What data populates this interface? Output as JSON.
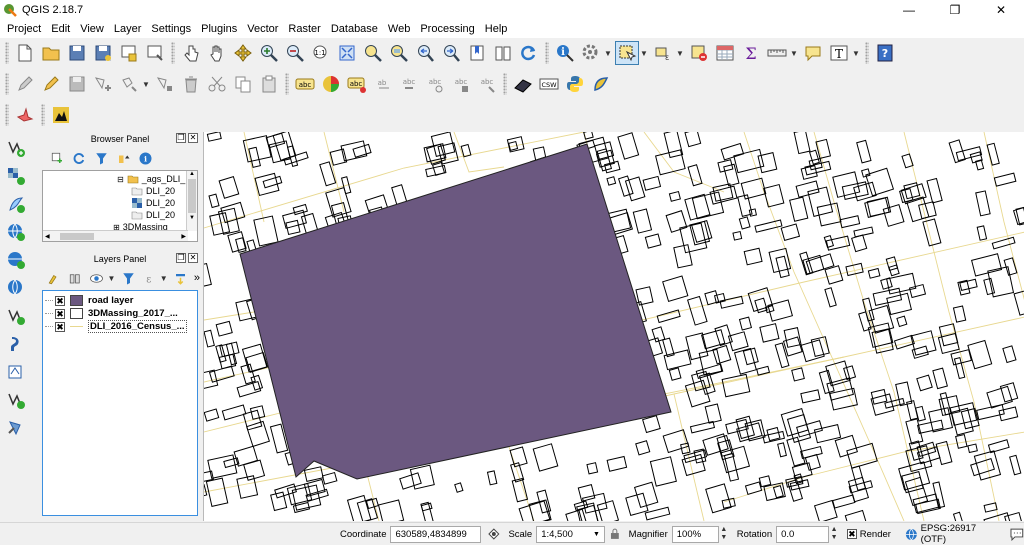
{
  "window": {
    "title": "QGIS 2.18.7",
    "minimize_glyph": "—",
    "restore_glyph": "❐",
    "close_glyph": "✕"
  },
  "menu": [
    "Project",
    "Edit",
    "View",
    "Layer",
    "Settings",
    "Plugins",
    "Vector",
    "Raster",
    "Database",
    "Web",
    "Processing",
    "Help"
  ],
  "toolbars": {
    "row1_icons": [
      "new-project-icon",
      "open-project-icon",
      "save-project-icon",
      "save-as-icon",
      "new-print-composer-icon",
      "composer-manager-icon",
      "touch-zoom-icon",
      "pan-icon",
      "pan-to-selection-icon",
      "zoom-in-icon",
      "zoom-out-icon",
      "zoom-native-icon",
      "zoom-full-icon",
      "zoom-to-selection-icon",
      "zoom-to-layer-icon",
      "zoom-last-icon",
      "zoom-next-icon",
      "new-bookmark-icon",
      "show-bookmarks-icon",
      "refresh-icon",
      "identify-icon",
      "run-action-icon",
      "select-features-icon",
      "select-by-value-icon",
      "deselect-icon",
      "attribute-table-icon",
      "statistics-icon",
      "measure-icon",
      "map-tips-icon",
      "text-annotation-icon",
      "help-icon"
    ],
    "row2_icons": [
      "current-edits-icon",
      "toggle-editing-icon",
      "save-edits-icon",
      "add-feature-icon",
      "move-feature-icon",
      "node-tool-icon",
      "delete-selected-icon",
      "cut-features-icon",
      "copy-features-icon",
      "paste-features-icon",
      "label-toolbar-icon",
      "diagram-icon",
      "pin-labels-icon",
      "show-hide-labels-icon",
      "move-label-icon",
      "rotate-label-icon",
      "change-label-icon",
      "unpin-label-icon",
      "georeferencer-icon",
      "csw-icon",
      "python-console-icon",
      "geocoding-icon"
    ],
    "row3_icons": [
      "plugin-a-icon",
      "plugin-b-icon"
    ]
  },
  "left_toolbar_icons": [
    "add-vector-layer-icon",
    "add-raster-layer-icon",
    "add-spatialite-icon",
    "add-wms-icon",
    "add-wcs-icon",
    "add-wfs-icon",
    "add-delimited-text-icon",
    "add-postgis-icon",
    "add-oracle-icon",
    "add-mssql-icon",
    "new-shapefile-icon",
    "processing-icon"
  ],
  "browser_panel": {
    "title": "Browser Panel",
    "items": [
      {
        "label": "_ags_DLI_",
        "icon": "folder-icon"
      },
      {
        "label": "DLI_20",
        "icon": "folder-icon"
      },
      {
        "label": "DLI_20",
        "icon": "raster-icon"
      },
      {
        "label": "DLI_20",
        "icon": "folder-icon"
      },
      {
        "label": "3DMassing_",
        "icon": "folder-icon"
      }
    ]
  },
  "layers_panel": {
    "title": "Layers Panel",
    "layers": [
      {
        "name": "road layer",
        "checked": true,
        "color": "#6b5880"
      },
      {
        "name": "3DMassing_2017_...",
        "checked": true,
        "color": "#ffffff"
      },
      {
        "name": "DLI_2016_Census_...",
        "checked": true,
        "color": "#ffffff"
      }
    ]
  },
  "map": {
    "polygon_fill": "#6b5880",
    "road_color": "#e8d890",
    "building_color": "#000000"
  },
  "status": {
    "coordinate_label": "Coordinate",
    "coordinate_value": "630589,4834899",
    "scale_label": "Scale",
    "scale_value": "1:4,500",
    "magnifier_label": "Magnifier",
    "magnifier_value": "100%",
    "rotation_label": "Rotation",
    "rotation_value": "0.0",
    "render_label": "Render",
    "render_checked": true,
    "crs_label": "EPSG:26917 (OTF)"
  }
}
